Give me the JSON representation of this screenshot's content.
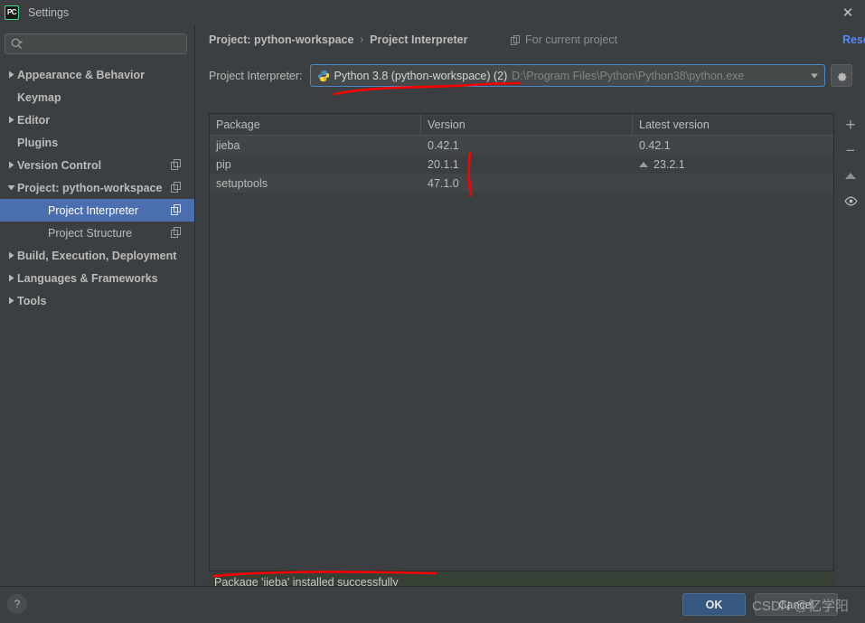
{
  "window": {
    "title": "Settings",
    "logo_text": "PC",
    "close_label": "✕"
  },
  "sidebar": {
    "search": {
      "placeholder": "",
      "value": "",
      "icon": "search-icon"
    },
    "items": [
      {
        "label": "Appearance & Behavior",
        "expandable": true,
        "expanded": false,
        "bold": true,
        "indent": 0,
        "copy_icon": false,
        "selected": false
      },
      {
        "label": "Keymap",
        "expandable": false,
        "expanded": false,
        "bold": true,
        "indent": 0,
        "copy_icon": false,
        "selected": false
      },
      {
        "label": "Editor",
        "expandable": true,
        "expanded": false,
        "bold": true,
        "indent": 0,
        "copy_icon": false,
        "selected": false
      },
      {
        "label": "Plugins",
        "expandable": false,
        "expanded": false,
        "bold": true,
        "indent": 0,
        "copy_icon": false,
        "selected": false
      },
      {
        "label": "Version Control",
        "expandable": true,
        "expanded": false,
        "bold": true,
        "indent": 0,
        "copy_icon": true,
        "selected": false
      },
      {
        "label": "Project: python-workspace",
        "expandable": true,
        "expanded": true,
        "bold": true,
        "indent": 0,
        "copy_icon": true,
        "selected": false
      },
      {
        "label": "Project Interpreter",
        "expandable": false,
        "expanded": false,
        "bold": false,
        "indent": 1,
        "copy_icon": true,
        "selected": true
      },
      {
        "label": "Project Structure",
        "expandable": false,
        "expanded": false,
        "bold": false,
        "indent": 1,
        "copy_icon": true,
        "selected": false
      },
      {
        "label": "Build, Execution, Deployment",
        "expandable": true,
        "expanded": false,
        "bold": true,
        "indent": 0,
        "copy_icon": false,
        "selected": false
      },
      {
        "label": "Languages & Frameworks",
        "expandable": true,
        "expanded": false,
        "bold": true,
        "indent": 0,
        "copy_icon": false,
        "selected": false
      },
      {
        "label": "Tools",
        "expandable": true,
        "expanded": false,
        "bold": true,
        "indent": 0,
        "copy_icon": false,
        "selected": false
      }
    ]
  },
  "main": {
    "breadcrumb": {
      "parent": "Project: python-workspace",
      "separator": "›",
      "current": "Project Interpreter"
    },
    "for_current_project": "For current project",
    "reset_link": "Reset",
    "interpreter": {
      "label": "Project Interpreter:",
      "value": "Python 3.8 (python-workspace) (2)",
      "path": "D:\\Program Files\\Python\\Python38\\python.exe",
      "icon": "python-icon",
      "gear_icon": "gear-icon"
    },
    "table": {
      "columns": [
        "Package",
        "Version",
        "Latest version"
      ],
      "rows": [
        {
          "package": "jieba",
          "version": "0.42.1",
          "latest": "0.42.1",
          "upgradable": false
        },
        {
          "package": "pip",
          "version": "20.1.1",
          "latest": "23.2.1",
          "upgradable": true
        },
        {
          "package": "setuptools",
          "version": "47.1.0",
          "latest": "",
          "upgradable": false
        }
      ]
    },
    "tools": [
      {
        "name": "add-package-button",
        "glyph": "+"
      },
      {
        "name": "remove-package-button",
        "glyph": "−"
      },
      {
        "name": "upgrade-package-button",
        "glyph": "▲"
      },
      {
        "name": "show-early-releases-button",
        "glyph": "◉"
      }
    ],
    "status_message": "Package 'jieba' installed successfully"
  },
  "footer": {
    "help_label": "?",
    "ok_label": "OK",
    "cancel_label": "Cancel"
  },
  "watermark": {
    "text": "CSDN @忆学阳"
  },
  "colors": {
    "background": "#3c3f41",
    "selection": "#4b6eaf",
    "accent_link": "#548af7",
    "ok_button": "#365880",
    "status_success_bg": "#364035",
    "annotation_red": "#ff0000",
    "combo_focus_border": "#4a88c7"
  }
}
